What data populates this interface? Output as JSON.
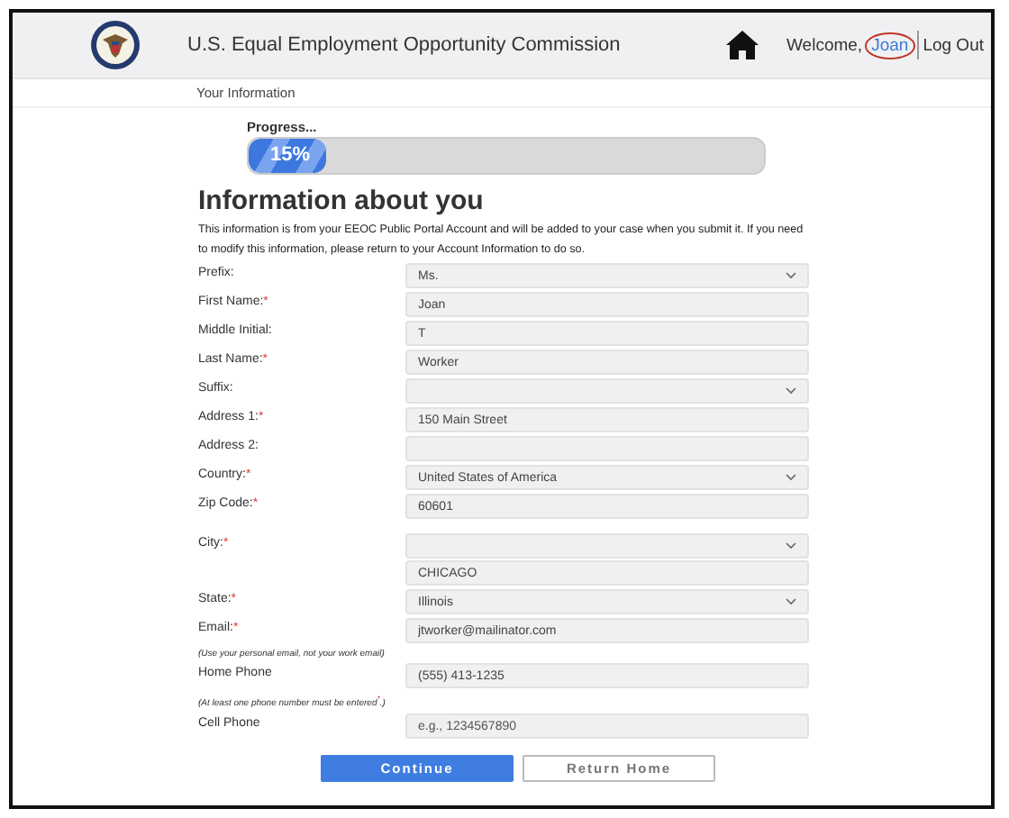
{
  "header": {
    "title": "U.S. Equal Employment Opportunity Commission",
    "welcome": "Welcome,",
    "user": {
      "name": "Joan",
      "highlighted": true
    },
    "logout": "Log Out"
  },
  "breadcrumb": "Your Information",
  "progress": {
    "label": "Progress...",
    "level": 0.15,
    "reading": "15%"
  },
  "heading": "Information about you",
  "intro": "This information is from your EEOC Public Portal Account and will be added to your case when you submit it. If you need to modify this information, please return to your Account Information to do so.",
  "rows": [
    {
      "kind": "field",
      "label": "Prefix:",
      "fields": [
        {
          "kind": "select",
          "value": "Ms."
        }
      ]
    },
    {
      "kind": "field",
      "label": "First Name:",
      "asterisk": "*",
      "fields": [
        {
          "kind": "text",
          "value": "Joan"
        }
      ]
    },
    {
      "kind": "field",
      "label": "Middle Initial:",
      "fields": [
        {
          "kind": "text",
          "value": "T"
        }
      ]
    },
    {
      "kind": "field",
      "label": "Last Name:",
      "asterisk": "*",
      "fields": [
        {
          "kind": "text",
          "value": "Worker"
        }
      ]
    },
    {
      "kind": "field",
      "label": "Suffix:",
      "fields": [
        {
          "kind": "select"
        }
      ]
    },
    {
      "kind": "field",
      "label": "Address 1:",
      "asterisk": "*",
      "fields": [
        {
          "kind": "text",
          "value": "150 Main Street"
        }
      ]
    },
    {
      "kind": "field",
      "label": "Address 2:",
      "fields": [
        {
          "kind": "text"
        }
      ]
    },
    {
      "kind": "field",
      "label": "Country:",
      "asterisk": "*",
      "fields": [
        {
          "kind": "select",
          "value": "United States of America"
        }
      ]
    },
    {
      "kind": "field",
      "label": "Zip Code:",
      "asterisk": "*",
      "fields": [
        {
          "kind": "text",
          "value": "60601"
        }
      ]
    },
    {
      "kind": "field",
      "label": "City:",
      "asterisk": "*",
      "fields": [
        {
          "kind": "select"
        },
        {
          "kind": "text",
          "value": "CHICAGO"
        }
      ]
    },
    {
      "kind": "field",
      "label": "State:",
      "asterisk": "*",
      "fields": [
        {
          "kind": "select",
          "value": "Illinois"
        }
      ]
    },
    {
      "kind": "field",
      "label": "Email:",
      "asterisk": "*",
      "fields": [
        {
          "kind": "text",
          "value": "jtworker@mailinator.com"
        }
      ]
    },
    {
      "kind": "note",
      "text": "(Use your personal email, not your work email)"
    },
    {
      "kind": "field",
      "label": "Home Phone",
      "fields": [
        {
          "kind": "text",
          "value": "(555) 413-1235"
        }
      ]
    },
    {
      "kind": "note",
      "text": "(At least one phone number must be entered$^{*}$.)"
    },
    {
      "kind": "field",
      "label": "Cell Phone",
      "fields": [
        {
          "kind": "text",
          "placeholder": "e.g., 1234567890"
        }
      ]
    }
  ],
  "buttons": [
    {
      "kind": "primary",
      "label": "Continue"
    },
    {
      "kind": "secondary",
      "label": "Return Home"
    }
  ]
}
